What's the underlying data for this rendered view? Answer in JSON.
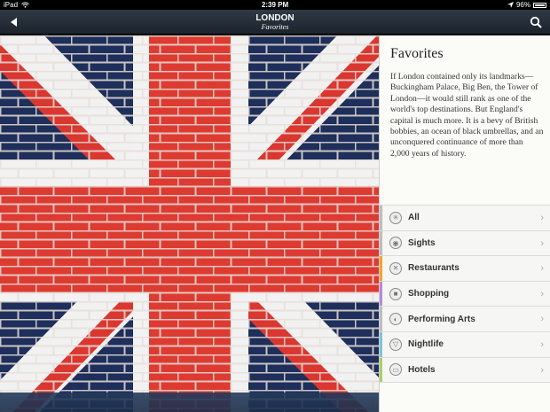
{
  "statusbar": {
    "device": "iPad",
    "time": "2:39 PM",
    "battery": "96%",
    "battery_level": 0.96
  },
  "navbar": {
    "title": "LONDON",
    "subtitle": "Favorites",
    "back_icon": "back-arrow-icon",
    "search_icon": "search-icon"
  },
  "photo": {
    "description_icon": "union-jack-brick-wall-photo"
  },
  "panel": {
    "title": "Favorites",
    "description": "If London contained only its landmarks—Buckingham Palace, Big Ben, the Tower of London—it would still rank as one of the world's top destinations. But England's capital is much more. It is a bevy of British bobbies, an ocean of black umbrellas, and an unconquered continuance of more than 2,000 years of history.",
    "items": [
      {
        "label": "All",
        "icon": "asterisk-icon",
        "color": "#bdbdbd",
        "glyph": "✳"
      },
      {
        "label": "Sights",
        "icon": "eye-icon",
        "color": "#bdbdbd",
        "glyph": "◉"
      },
      {
        "label": "Restaurants",
        "icon": "fork-knife-icon",
        "color": "#f2a531",
        "glyph": "✕"
      },
      {
        "label": "Shopping",
        "icon": "shopping-bag-icon",
        "color": "#b98ad0",
        "glyph": "■"
      },
      {
        "label": "Performing Arts",
        "icon": "masks-icon",
        "color": "#bdbdbd",
        "glyph": "◐"
      },
      {
        "label": "Nightlife",
        "icon": "cocktail-icon",
        "color": "#7fc3d9",
        "glyph": "▽"
      },
      {
        "label": "Hotels",
        "icon": "bed-icon",
        "color": "#a8cf6a",
        "glyph": "▭"
      }
    ]
  }
}
